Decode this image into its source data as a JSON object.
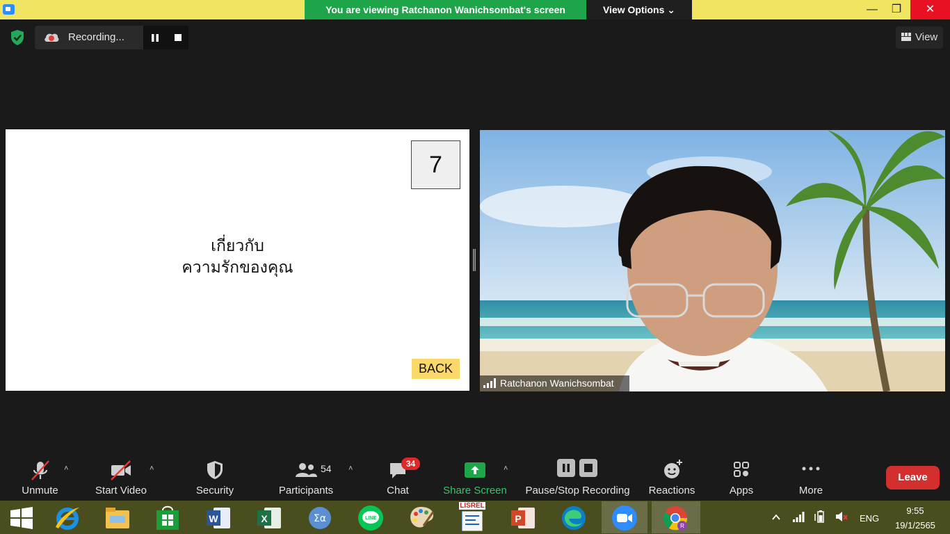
{
  "topbar": {
    "banner_text": "You are viewing Ratchanon Wanichsombat's screen",
    "view_options_label": "View Options ⌄",
    "minimize_glyph": "—",
    "maximize_glyph": "❐",
    "close_glyph": "✕"
  },
  "recording": {
    "label": "Recording..."
  },
  "view_button": {
    "label": "View"
  },
  "slide": {
    "number": "7",
    "title_line1": "เกี่ยวกับ",
    "title_line2": "ความรักของคุณ",
    "back_label": "BACK"
  },
  "video": {
    "participant_name": "Ratchanon Wanichsombat"
  },
  "toolbar": {
    "unmute": "Unmute",
    "start_video": "Start Video",
    "security": "Security",
    "participants": "Participants",
    "participants_count": "54",
    "chat": "Chat",
    "chat_badge": "34",
    "share_screen": "Share Screen",
    "recording": "Pause/Stop Recording",
    "reactions": "Reactions",
    "apps": "Apps",
    "more": "More",
    "leave": "Leave",
    "caret": "˄"
  },
  "taskbar": {
    "lisrel_label": "LISREL",
    "lang": "ENG",
    "time": "9:55",
    "date": "19/1/2565"
  },
  "colors": {
    "share_green": "#1ea549",
    "banner_yellow": "#f0e561",
    "leave_red": "#d32f2f",
    "badge_red": "#e02828",
    "back_yellow": "#fad86a"
  }
}
